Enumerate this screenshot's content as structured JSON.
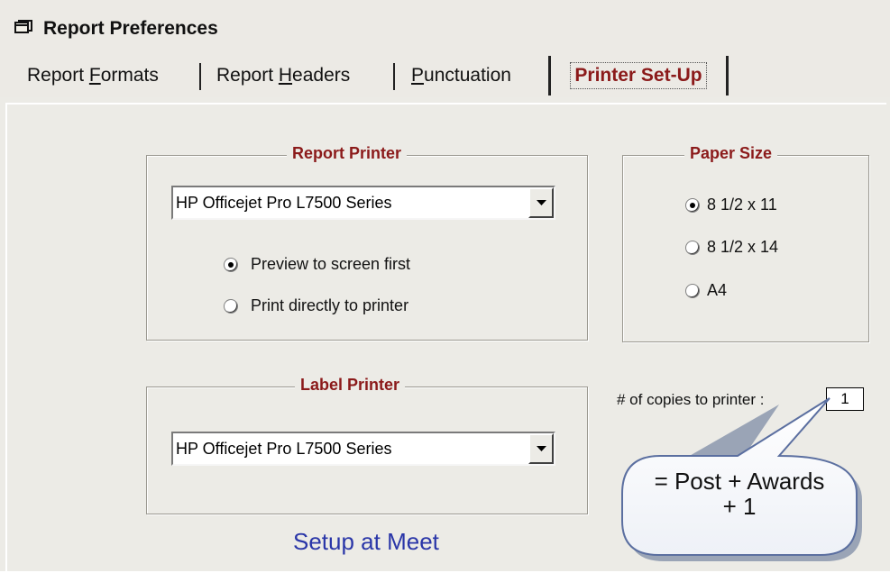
{
  "window": {
    "title": "Report Preferences",
    "icon": "window-app-icon"
  },
  "tabs": [
    {
      "pre": "Report ",
      "accel": "F",
      "post": "ormats",
      "active": false
    },
    {
      "pre": "Report ",
      "accel": "H",
      "post": "eaders",
      "active": false
    },
    {
      "pre": "",
      "accel": "P",
      "post": "unctuation",
      "active": false
    },
    {
      "label": "Printer Set-Up",
      "active": true
    }
  ],
  "report_printer": {
    "legend": "Report Printer",
    "selected": "HP Officejet Pro L7500 Series",
    "options": [
      {
        "label": "Preview to screen first",
        "checked": true
      },
      {
        "label": "Print directly to printer",
        "checked": false
      }
    ]
  },
  "paper_size": {
    "legend": "Paper Size",
    "options": [
      {
        "label": "8 1/2 x 11",
        "checked": true
      },
      {
        "label": "8 1/2 x 14",
        "checked": false
      },
      {
        "label": "A4",
        "checked": false
      }
    ]
  },
  "label_printer": {
    "legend": "Label Printer",
    "selected": "HP Officejet Pro L7500 Series"
  },
  "copies": {
    "label": "# of copies to printer :",
    "value": "1"
  },
  "setup_at_meet": "Setup at Meet",
  "callout": {
    "line1": "= Post + Awards",
    "line2": "+ 1"
  },
  "colors": {
    "legend": "#8b1a1a",
    "active_tab": "#8b1a1a",
    "setup_link": "#2a36a8",
    "pane_bg": "#ecebe6"
  }
}
